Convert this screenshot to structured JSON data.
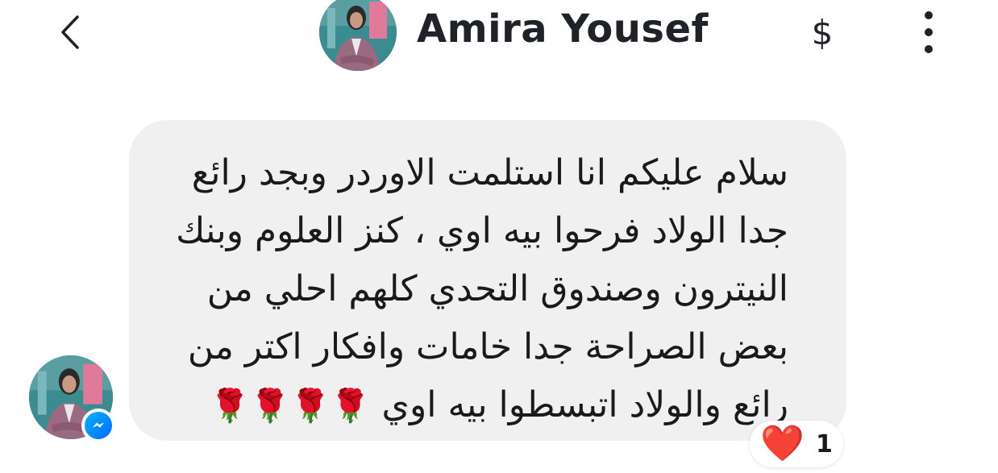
{
  "header": {
    "contact_name": "Amira Yousef",
    "back_icon": "chevron-left-icon",
    "payment_symbol": "$",
    "menu_icon": "more-vertical-icon"
  },
  "message": {
    "lines": [
      "سلام عليكم انا استلمت الاوردر وبجد رائع",
      "جدا الولاد فرحوا بيه اوي ، كنز العلوم وبنك",
      "النيترون وصندوق التحدي كلهم احلي من",
      "بعض الصراحة جدا خامات وافكار اكتر من",
      "رائع والولاد اتبسطوا بيه اوي"
    ],
    "emoji": "🌹🌹🌹🌹",
    "bubble_color": "#f0f0f0"
  },
  "reaction": {
    "emoji": "❤️",
    "count": "1"
  },
  "badge": {
    "icon": "messenger-icon",
    "color": "#0a7cff"
  }
}
